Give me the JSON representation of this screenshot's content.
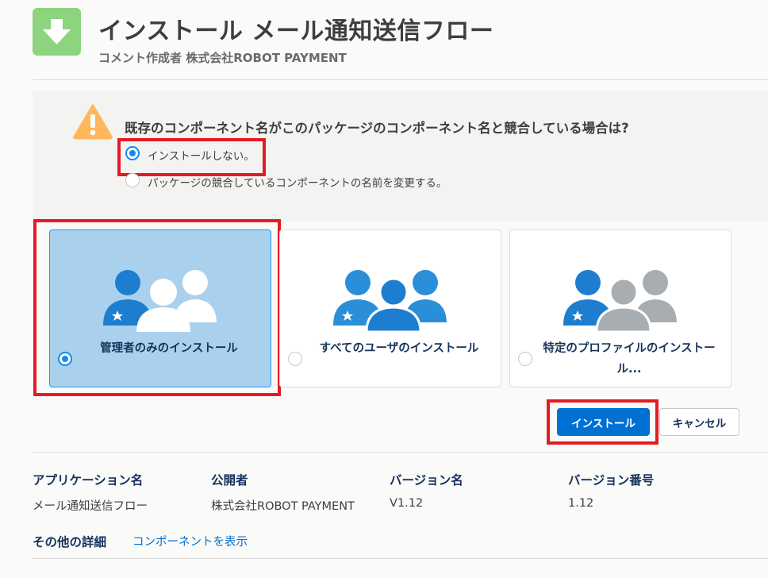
{
  "header": {
    "title": "インストール メール通知送信フロー",
    "subtitle": "コメント作成者 株式会社ROBOT PAYMENT"
  },
  "conflict": {
    "question": "既存のコンポーネント名がこのパッケージのコンポーネント名と競合している場合は?",
    "options": [
      {
        "label": "インストールしない。",
        "selected": true
      },
      {
        "label": "パッケージの競合しているコンポーネントの名前を変更する。",
        "selected": false
      }
    ]
  },
  "install_options": [
    {
      "label": "管理者のみのインストール",
      "selected": true,
      "icon": "admin-users-icon"
    },
    {
      "label": "すべてのユーザのインストール",
      "selected": false,
      "icon": "all-users-icon"
    },
    {
      "label": "特定のプロファイルのインストール...",
      "selected": false,
      "icon": "profile-users-icon"
    }
  ],
  "buttons": {
    "install": "インストール",
    "cancel": "キャンセル"
  },
  "details": {
    "columns": [
      {
        "header": "アプリケーション名",
        "value": "メール通知送信フロー"
      },
      {
        "header": "公開者",
        "value": "株式会社ROBOT PAYMENT"
      },
      {
        "header": "バージョン名",
        "value": "V1.12"
      },
      {
        "header": "バージョン番号",
        "value": "1.12"
      }
    ],
    "other_label": "その他の詳細",
    "components_link": "コンポーネントを表示"
  },
  "colors": {
    "primary": "#0070d2",
    "selected_card": "#a9d1ee",
    "highlight": "#e41b23",
    "app_icon": "#8ed37e",
    "warning": "#ffb75d"
  }
}
